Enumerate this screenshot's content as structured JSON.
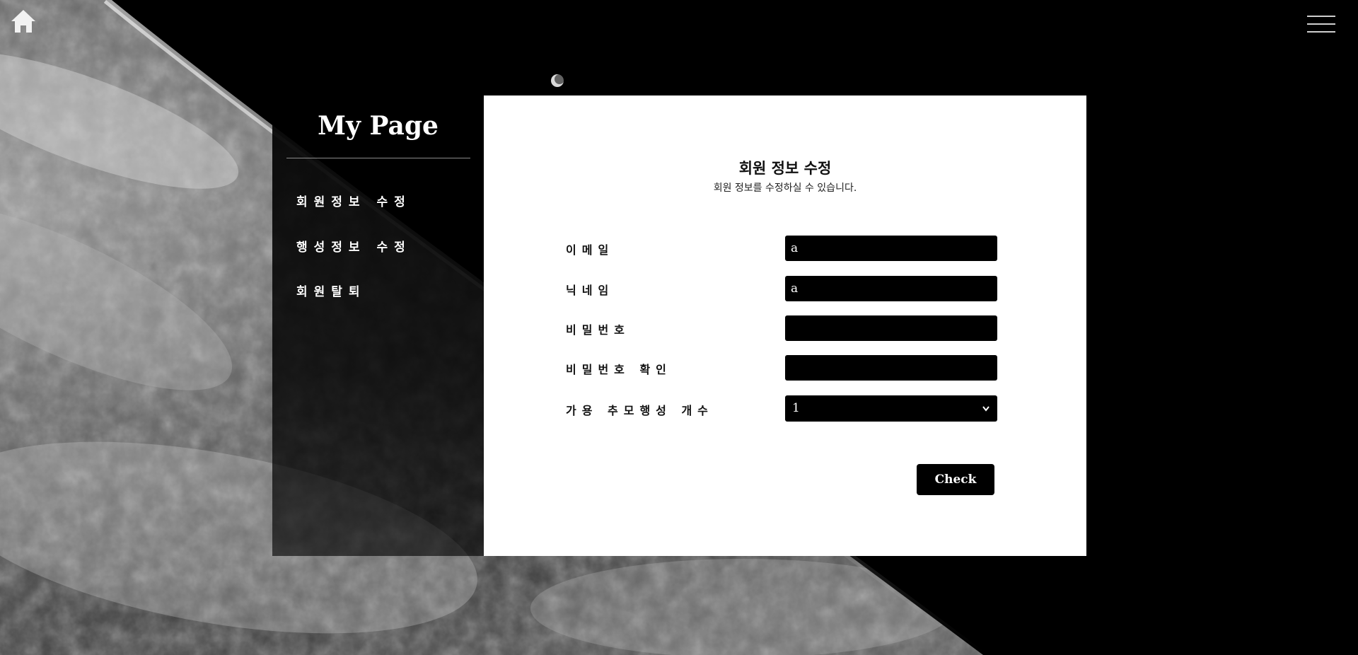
{
  "header": {
    "home_icon": "home-icon",
    "menu_icon": "hamburger-menu-icon"
  },
  "sidebar": {
    "title": "My Page",
    "items": [
      {
        "label": "회원정보 수정"
      },
      {
        "label": "행성정보 수정"
      },
      {
        "label": "회원탈퇴"
      }
    ]
  },
  "form": {
    "title": "회원 정보 수정",
    "subtitle": "회원 정보를 수정하실 수 있습니다.",
    "fields": [
      {
        "label": "이메일",
        "value": "a"
      },
      {
        "label": "닉네임",
        "value": "a"
      },
      {
        "label": "비밀번호",
        "value": ""
      },
      {
        "label": "비밀번호 확인",
        "value": ""
      }
    ],
    "planet_count": {
      "label": "가용 추모행성 개수",
      "selected": "1"
    },
    "submit_label": "Check"
  },
  "colors": {
    "background": "#000000",
    "panel": "#ffffff",
    "input": "#000000",
    "text_light": "#ffffff"
  }
}
